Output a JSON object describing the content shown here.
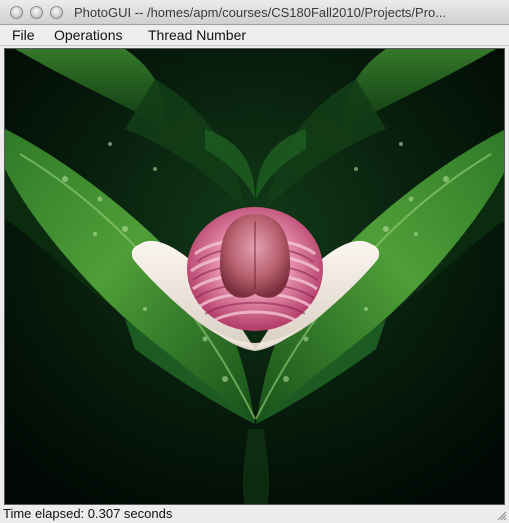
{
  "window": {
    "title": "PhotoGUI -- /homes/apm/courses/CS180Fall2010/Projects/Pro..."
  },
  "menu": {
    "file": "File",
    "operations": "Operations",
    "thread_number": "Thread Number"
  },
  "image": {
    "description_icon": "photo-canvas"
  },
  "status": {
    "text": "Time elapsed: 0.307 seconds"
  },
  "colors": {
    "leaf_light": "#5fae3e",
    "leaf_dark": "#0f3b12",
    "background": "#05140a",
    "flower_pink": "#d24a78",
    "flower_cream": "#efe6dc"
  }
}
